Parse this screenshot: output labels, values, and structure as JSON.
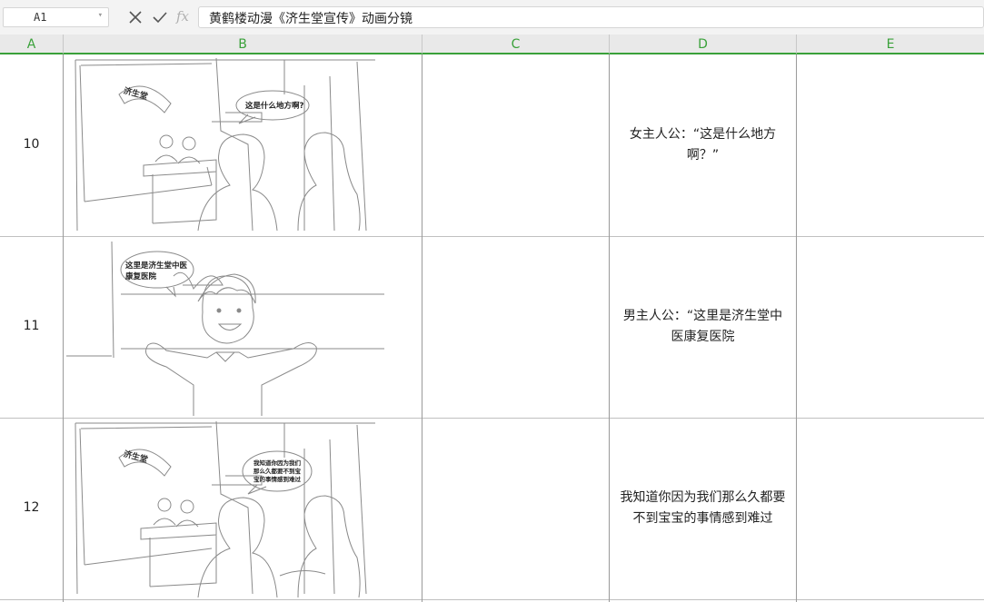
{
  "formula_bar": {
    "cell_ref": "A1",
    "formula": "黄鹤楼动漫《济生堂宣传》动画分镜",
    "cancel_icon": "close-icon",
    "accept_icon": "check-icon",
    "fx_label": "fx"
  },
  "columns": [
    "A",
    "B",
    "C",
    "D",
    "E"
  ],
  "rows": [
    {
      "number": "10",
      "panel_sign": "济生堂",
      "panel_bubble": "这是什么地方啊?",
      "description_line1": "女主人公：“这是什么地方",
      "description_line2": "啊？”"
    },
    {
      "number": "11",
      "panel_bubble_line1": "这里是济生堂中医",
      "panel_bubble_line2": "康复医院",
      "description_line1": "男主人公：“这里是济生堂中",
      "description_line2": "医康复医院"
    },
    {
      "number": "12",
      "panel_sign": "济生堂",
      "panel_bubble_line1": "我知道你因为我们",
      "panel_bubble_line2": "那么久都要不到宝",
      "panel_bubble_line3": "宝的事情感到难过",
      "description_line1": "我知道你因为我们那么久都要",
      "description_line2": "不到宝宝的事情感到难过"
    }
  ],
  "colors": {
    "header_accent": "#3aa13a",
    "gridline": "#c0c0c0",
    "sketch": "#888888"
  }
}
